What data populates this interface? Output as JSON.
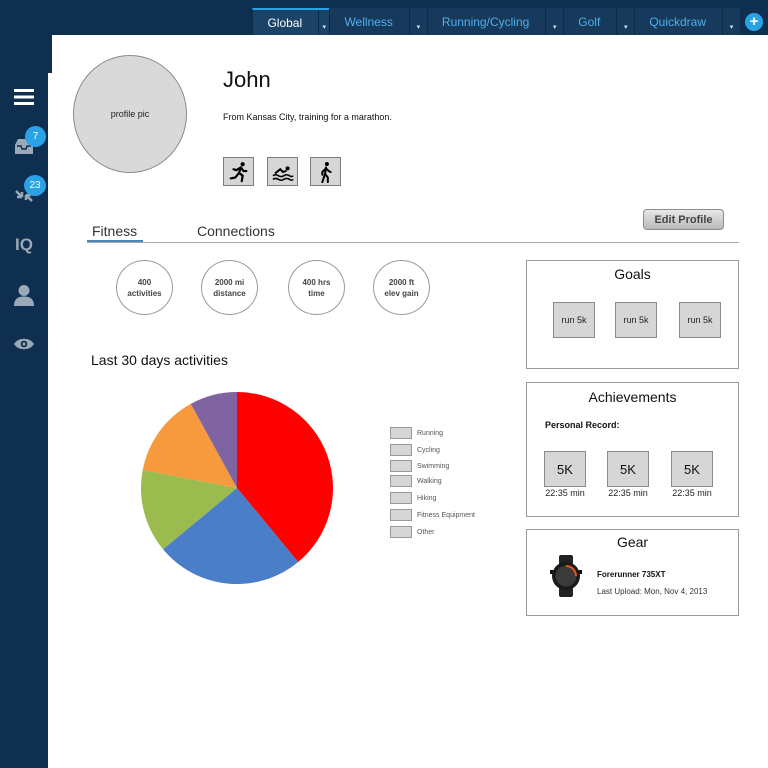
{
  "nav": {
    "tabs": [
      {
        "label": "Global",
        "active": true
      },
      {
        "label": "Wellness"
      },
      {
        "label": "Running/Cycling"
      },
      {
        "label": "Golf"
      },
      {
        "label": "Quickdraw"
      }
    ],
    "add_icon": "plus-icon",
    "add_label": "+",
    "caret": "▾"
  },
  "sidebar": {
    "items": [
      {
        "icon": "hamburger-menu-icon"
      },
      {
        "icon": "inbox-icon",
        "badge": "7"
      },
      {
        "icon": "connections-icon",
        "badge": "23"
      },
      {
        "icon": "connect-iq-icon",
        "label": "IQ"
      },
      {
        "icon": "user-icon"
      },
      {
        "icon": "eye-icon"
      }
    ]
  },
  "profile": {
    "pic_label": "profile pic",
    "name": "John",
    "bio": "From Kansas City, training for a marathon.",
    "sports": [
      "running-icon",
      "swimming-icon",
      "walking-icon"
    ],
    "edit_label": "Edit Profile"
  },
  "tabs": {
    "fitness": "Fitness",
    "connections": "Connections"
  },
  "stats": [
    {
      "value": "400",
      "label": "activities"
    },
    {
      "value": "2000 mi",
      "label": "distance"
    },
    {
      "value": "400 hrs",
      "label": "time"
    },
    {
      "value": "2000 ft",
      "label": "elev gain"
    }
  ],
  "activities": {
    "title": "Last 30 days activities"
  },
  "chart_data": {
    "type": "pie",
    "title": "",
    "slices": [
      {
        "value": 39,
        "color": "#ff0000"
      },
      {
        "value": 25,
        "color": "#4a7ec9"
      },
      {
        "value": 14,
        "color": "#9bbb4e"
      },
      {
        "value": 14,
        "color": "#f79a3e"
      },
      {
        "value": 8,
        "color": "#8064a2"
      }
    ],
    "legend": [
      "Running",
      "Cycling",
      "Swimming",
      "Walking",
      "Hiking",
      "Fitness Equipment",
      "Other"
    ]
  },
  "goals": {
    "title": "Goals",
    "items": [
      "run 5k",
      "run 5k",
      "run 5k"
    ]
  },
  "achievements": {
    "title": "Achievements",
    "subtitle": "Personal Record:",
    "items": [
      {
        "label": "5K",
        "time": "22:35 min"
      },
      {
        "label": "5K",
        "time": "22:35 min"
      },
      {
        "label": "5K",
        "time": "22:35 min"
      }
    ]
  },
  "gear": {
    "title": "Gear",
    "device_name": "Forerunner 735XT",
    "last_upload": "Last Upload: Mon, Nov 4, 2013",
    "icon": "watch-icon"
  }
}
